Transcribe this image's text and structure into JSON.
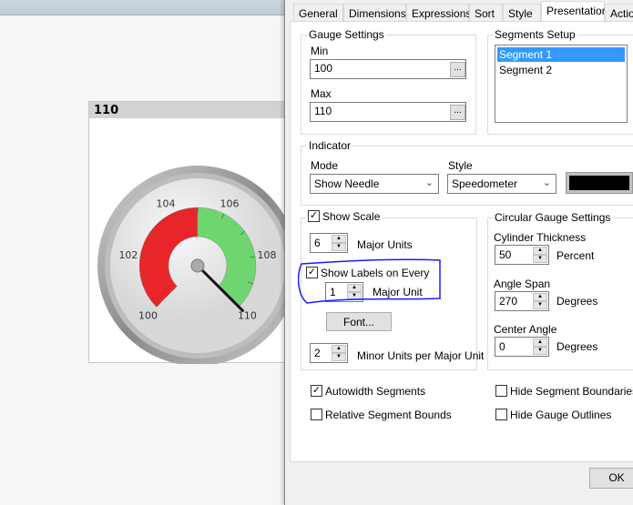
{
  "gauge_chart": {
    "title": "110",
    "chart_data": {
      "type": "gauge",
      "min": 100,
      "max": 110,
      "value": 110,
      "angle_span_deg": 270,
      "center_angle_deg": 0,
      "tick_labels": [
        "100",
        "102",
        "104",
        "106",
        "108",
        "110"
      ],
      "major_ticks": [
        100,
        102,
        104,
        106,
        108,
        110
      ],
      "minor_units_per_major": 2,
      "segments": [
        {
          "from": 100,
          "to": 105,
          "color": "#e8262a"
        },
        {
          "from": 105,
          "to": 110,
          "color": "#6fd66f"
        }
      ],
      "needle_color": "#111111"
    }
  },
  "dialog": {
    "tabs": [
      "General",
      "Dimensions",
      "Expressions",
      "Sort",
      "Style",
      "Presentation",
      "Actions"
    ],
    "active_tab": "Presentation",
    "gauge_settings": {
      "title": "Gauge Settings",
      "min_label": "Min",
      "min_value": "100",
      "max_label": "Max",
      "max_value": "110",
      "browse": "..."
    },
    "segments_setup": {
      "title": "Segments Setup",
      "items": [
        "Segment 1",
        "Segment 2"
      ],
      "selected": "Segment 1"
    },
    "indicator": {
      "title": "Indicator",
      "mode_label": "Mode",
      "mode_value": "Show Needle",
      "style_label": "Style",
      "style_value": "Speedometer",
      "color": "#000000"
    },
    "scale": {
      "show_scale_label": "Show Scale",
      "show_scale": true,
      "major_units": "6",
      "major_units_label": "Major Units",
      "show_labels_label": "Show Labels on Every",
      "show_labels": true,
      "label_every": "1",
      "major_unit_label": "Major Unit",
      "font_button": "Font...",
      "minor_units": "2",
      "minor_units_label": "Minor Units per Major Unit"
    },
    "circular": {
      "title": "Circular Gauge Settings",
      "cyl_label": "Cylinder Thickness",
      "cyl_value": "50",
      "percent": "Percent",
      "span_label": "Angle Span",
      "span_value": "270",
      "degrees": "Degrees",
      "center_label": "Center Angle",
      "center_value": "0"
    },
    "options": [
      {
        "label": "Autowidth Segments",
        "checked": true
      },
      {
        "label": "Relative Segment Bounds",
        "checked": false
      },
      {
        "label": "Hide Segment Boundaries",
        "checked": false
      },
      {
        "label": "Hide Gauge Outlines",
        "checked": false
      }
    ],
    "ok_label": "OK",
    "annotation_color": "#1a1aff"
  }
}
